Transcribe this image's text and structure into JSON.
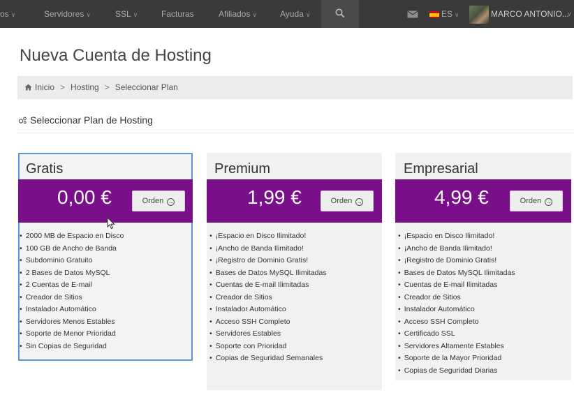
{
  "nav": {
    "items": [
      {
        "label": "os",
        "has_chevron": true
      },
      {
        "label": "Servidores",
        "has_chevron": true
      },
      {
        "label": "SSL",
        "has_chevron": true
      },
      {
        "label": "Facturas",
        "has_chevron": false
      },
      {
        "label": "Afiliados",
        "has_chevron": true
      },
      {
        "label": "Ayuda",
        "has_chevron": true
      }
    ],
    "search_icon": "search-icon",
    "mail_icon": "envelope-icon",
    "language": "ES",
    "user_name": "MARCO ANTONIO..."
  },
  "page": {
    "title": "Nueva Cuenta de Hosting",
    "breadcrumb": [
      "Inicio",
      "Hosting",
      "Seleccionar Plan"
    ],
    "section_title": "Seleccionar Plan de Hosting"
  },
  "colors": {
    "topbar": "#3a3a3a",
    "price_bar": "#7a0f8a",
    "selected_border": "#5b9bd5"
  },
  "plans": [
    {
      "name": "Gratis",
      "price": "0,00 €",
      "order_label": "Orden",
      "selected": true,
      "features": [
        "2000 MB de Espacio en Disco",
        "100 GB de Ancho de Banda",
        "Subdominio Gratuito",
        "2 Bases de Datos MySQL",
        "2 Cuentas de E-mail",
        "Creador de Sitios",
        "Instalador Automático",
        "Servidores Menos Estables",
        "Soporte de Menor Prioridad",
        "Sin Copias de Seguridad"
      ]
    },
    {
      "name": "Premium",
      "price": "1,99 €",
      "order_label": "Orden",
      "selected": false,
      "features": [
        "¡Espacio en Disco Ilimitado!",
        "¡Ancho de Banda Ilimitado!",
        "¡Registro de Dominio Gratis!",
        "Bases de Datos MySQL Ilimitadas",
        "Cuentas de E-mail Ilimitadas",
        "Creador de Sitios",
        "Instalador Automático",
        "Acceso SSH Completo",
        "Servidores Estables",
        "Soporte con Prioridad",
        "Copias de Seguridad Semanales"
      ]
    },
    {
      "name": "Empresarial",
      "price": "4,99 €",
      "order_label": "Orden",
      "selected": false,
      "features": [
        "¡Espacio en Disco Ilimitado!",
        "¡Ancho de Banda Ilimitado!",
        "¡Registro de Dominio Gratis!",
        "Bases de Datos MySQL Ilimitadas",
        "Cuentas de E-mail Ilimitadas",
        "Creador de Sitios",
        "Instalador Automático",
        "Acceso SSH Completo",
        "Certificado SSL",
        "Servidores Altamente Estables",
        "Soporte de la Mayor Prioridad",
        "Copias de Seguridad Diarias"
      ]
    }
  ]
}
